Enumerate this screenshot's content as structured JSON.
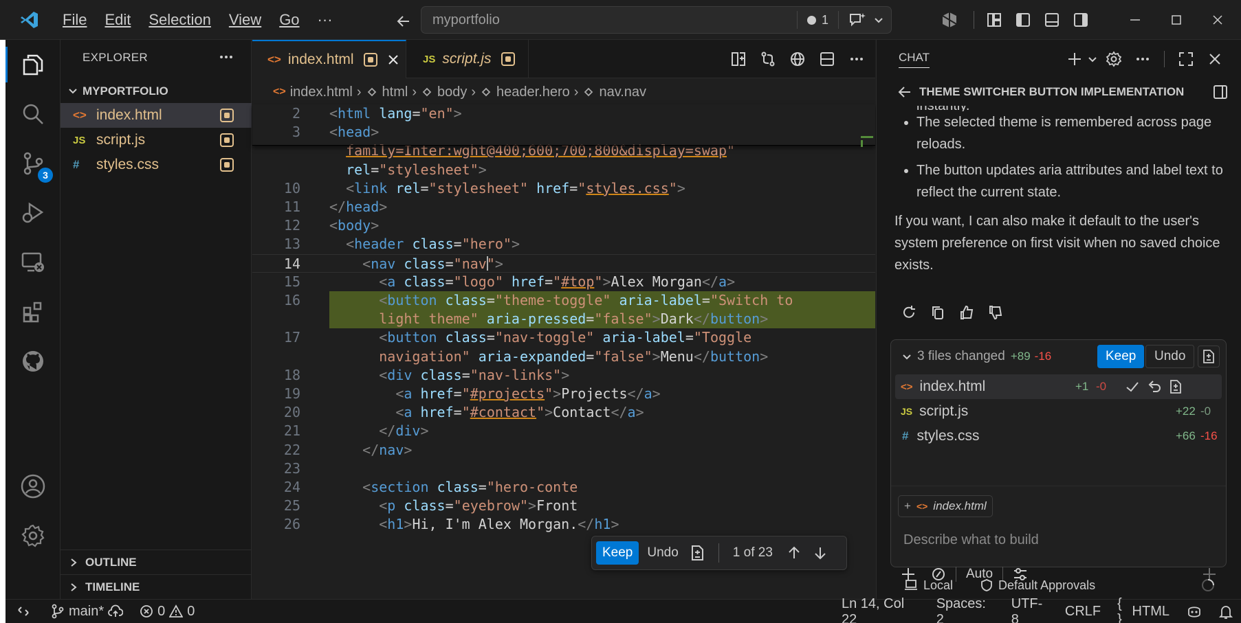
{
  "titlebar": {
    "menus": [
      "File",
      "Edit",
      "Selection",
      "View",
      "Go"
    ],
    "menu_more": "···",
    "search_text": "myportfolio",
    "problems_count": "1"
  },
  "activity": {
    "source_control_badge": "3"
  },
  "explorer": {
    "title": "EXPLORER",
    "folder": "MYPORTFOLIO",
    "files": [
      {
        "name": "index.html",
        "icon": "<>",
        "icon_color": "#e37933"
      },
      {
        "name": "script.js",
        "icon": "JS",
        "icon_color": "#cbcb41"
      },
      {
        "name": "styles.css",
        "icon": "#",
        "icon_color": "#519aba"
      }
    ],
    "outline": "OUTLINE",
    "timeline": "TIMELINE"
  },
  "tabs": [
    {
      "label": "index.html",
      "icon": "<>"
    },
    {
      "label": "script.js",
      "icon": "JS"
    }
  ],
  "breadcrumb": [
    "index.html",
    "html",
    "body",
    "header.hero",
    "nav.nav"
  ],
  "code_lines": [
    {
      "n": "2",
      "html": "<span class='t-br'>&lt;</span><span class='t-tag'>html</span> <span class='t-attr'>lang</span><span class='t-txt'>=</span><span class='t-val'>\"en\"</span><span class='t-br'>&gt;</span>"
    },
    {
      "n": "3",
      "html": "<span class='t-br'>&lt;</span><span class='t-tag'>head</span><span class='t-br'>&gt;</span>"
    },
    {
      "n": "",
      "html": "  <span class='t-link'>family=Inter:wght@400;600;700;800&amp;display=swap</span><span class='t-val'>\"</span>"
    },
    {
      "n": "",
      "html": "  <span class='t-attr'>rel</span><span class='t-txt'>=</span><span class='t-val'>\"stylesheet\"</span><span class='t-br'>&gt;</span>"
    },
    {
      "n": "10",
      "html": "  <span class='t-br'>&lt;</span><span class='t-tag'>link</span> <span class='t-attr'>rel</span><span class='t-txt'>=</span><span class='t-val'>\"stylesheet\"</span> <span class='t-attr'>href</span><span class='t-txt'>=</span><span class='t-val'>\"</span><span class='t-link'>styles.css</span><span class='t-val'>\"</span><span class='t-br'>&gt;</span>"
    },
    {
      "n": "11",
      "html": "<span class='t-br'>&lt;/</span><span class='t-tag'>head</span><span class='t-br'>&gt;</span>"
    },
    {
      "n": "12",
      "html": "<span class='t-br'>&lt;</span><span class='t-tag'>body</span><span class='t-br'>&gt;</span>"
    },
    {
      "n": "13",
      "html": "  <span class='t-br'>&lt;</span><span class='t-tag'>header</span> <span class='t-attr'>class</span><span class='t-txt'>=</span><span class='t-val'>\"hero\"</span><span class='t-br'>&gt;</span>"
    },
    {
      "n": "14",
      "html": "    <span class='t-br'>&lt;</span><span class='t-tag'>nav</span> <span class='t-attr'>class</span><span class='t-txt'>=</span><span class='t-val'>\"nav\"</span><span class='t-br'>&gt;</span>",
      "current": true
    },
    {
      "n": "15",
      "html": "      <span class='t-br'>&lt;</span><span class='t-tag'>a</span> <span class='t-attr'>class</span><span class='t-txt'>=</span><span class='t-val'>\"logo\"</span> <span class='t-attr'>href</span><span class='t-txt'>=</span><span class='t-val'>\"</span><span class='t-link'>#top</span><span class='t-val'>\"</span><span class='t-br'>&gt;</span><span class='t-txt'>Alex Morgan</span><span class='t-br'>&lt;/</span><span class='t-tag'>a</span><span class='t-br'>&gt;</span>"
    },
    {
      "n": "16",
      "html": "      <span class='t-br'>&lt;</span><span class='t-tag'>button</span> <span class='t-attr'>class</span><span class='t-txt'>=</span><span class='t-val'>\"theme-toggle\"</span> <span class='t-attr'>aria-label</span><span class='t-txt'>=</span><span class='t-val'>\"Switch to</span>",
      "added": true
    },
    {
      "n": "",
      "html": "      <span class='t-val'>light theme\"</span> <span class='t-attr'>aria-pressed</span><span class='t-txt'>=</span><span class='t-val'>\"false\"</span><span class='t-br'>&gt;</span><span class='t-txt'>Dark</span><span class='t-br'>&lt;/</span><span class='t-tag'>button</span><span class='t-br'>&gt;</span>",
      "added": true
    },
    {
      "n": "17",
      "html": "      <span class='t-br'>&lt;</span><span class='t-tag'>button</span> <span class='t-attr'>class</span><span class='t-txt'>=</span><span class='t-val'>\"nav-toggle\"</span> <span class='t-attr'>aria-label</span><span class='t-txt'>=</span><span class='t-val'>\"Toggle</span>"
    },
    {
      "n": "",
      "html": "      <span class='t-val'>navigation\"</span> <span class='t-attr'>aria-expanded</span><span class='t-txt'>=</span><span class='t-val'>\"false\"</span><span class='t-br'>&gt;</span><span class='t-txt'>Menu</span><span class='t-br'>&lt;/</span><span class='t-tag'>button</span><span class='t-br'>&gt;</span>"
    },
    {
      "n": "18",
      "html": "      <span class='t-br'>&lt;</span><span class='t-tag'>div</span> <span class='t-attr'>class</span><span class='t-txt'>=</span><span class='t-val'>\"nav-links\"</span><span class='t-br'>&gt;</span>"
    },
    {
      "n": "19",
      "html": "        <span class='t-br'>&lt;</span><span class='t-tag'>a</span> <span class='t-attr'>href</span><span class='t-txt'>=</span><span class='t-val'>\"</span><span class='t-link'>#projects</span><span class='t-val'>\"</span><span class='t-br'>&gt;</span><span class='t-txt'>Projects</span><span class='t-br'>&lt;/</span><span class='t-tag'>a</span><span class='t-br'>&gt;</span>"
    },
    {
      "n": "20",
      "html": "        <span class='t-br'>&lt;</span><span class='t-tag'>a</span> <span class='t-attr'>href</span><span class='t-txt'>=</span><span class='t-val'>\"</span><span class='t-link'>#contact</span><span class='t-val'>\"</span><span class='t-br'>&gt;</span><span class='t-txt'>Contact</span><span class='t-br'>&lt;/</span><span class='t-tag'>a</span><span class='t-br'>&gt;</span>"
    },
    {
      "n": "21",
      "html": "      <span class='t-br'>&lt;/</span><span class='t-tag'>div</span><span class='t-br'>&gt;</span>"
    },
    {
      "n": "22",
      "html": "    <span class='t-br'>&lt;/</span><span class='t-tag'>nav</span><span class='t-br'>&gt;</span>"
    },
    {
      "n": "23",
      "html": ""
    },
    {
      "n": "24",
      "html": "    <span class='t-br'>&lt;</span><span class='t-tag'>section</span> <span class='t-attr'>class</span><span class='t-txt'>=</span><span class='t-val'>\"hero-conte</span>"
    },
    {
      "n": "25",
      "html": "      <span class='t-br'>&lt;</span><span class='t-tag'>p</span> <span class='t-attr'>class</span><span class='t-txt'>=</span><span class='t-val'>\"eyebrow\"</span><span class='t-br'>&gt;</span><span class='t-txt'>Front</span>"
    },
    {
      "n": "26",
      "html": "      <span class='t-br'>&lt;</span><span class='t-tag'>h1</span><span class='t-br'>&gt;</span><span class='t-txt'>Hi, I'm Alex Morgan.</span><span class='t-br'>&lt;/</span><span class='t-tag'>h1</span><span class='t-br'>&gt;</span>"
    }
  ],
  "inline_review": {
    "keep": "Keep",
    "undo": "Undo",
    "counter": "1 of 23"
  },
  "chat": {
    "header": "CHAT",
    "title": "THEME SWITCHER BUTTON IMPLEMENTATION",
    "partial_top": "instantly.",
    "bullets": [
      "The selected theme is remembered across page reloads.",
      "The button updates aria attributes and label text to reflect the current state."
    ],
    "paragraph": "If you want, I can also make it default to the user's system preference on first visit when no saved choice exists.",
    "changes": {
      "summary": "3 files changed",
      "added": "+89",
      "removed": "-16",
      "keep": "Keep",
      "undo": "Undo",
      "files": [
        {
          "name": "index.html",
          "icon": "<>",
          "icon_color": "#e37933",
          "add": "+1",
          "del": "-0"
        },
        {
          "name": "script.js",
          "icon": "JS",
          "icon_color": "#cbcb41",
          "add": "+22",
          "del": "-0"
        },
        {
          "name": "styles.css",
          "icon": "#",
          "icon_color": "#519aba",
          "add": "+66",
          "del": "-16"
        }
      ]
    },
    "context_chip": "index.html",
    "input_placeholder": "Describe what to build",
    "mode": "Auto",
    "footer_location": "Local",
    "footer_approvals": "Default Approvals"
  },
  "status": {
    "branch": "main*",
    "errors": "0",
    "warnings": "0",
    "position": "Ln 14, Col 22",
    "spaces": "Spaces: 2",
    "encoding": "UTF-8",
    "eol": "CRLF",
    "language": "HTML",
    "language_icon": "{ }"
  },
  "colors": {
    "accent": "#0078d4",
    "added_line": "#4b5a22",
    "modified": "#e2c08d"
  }
}
